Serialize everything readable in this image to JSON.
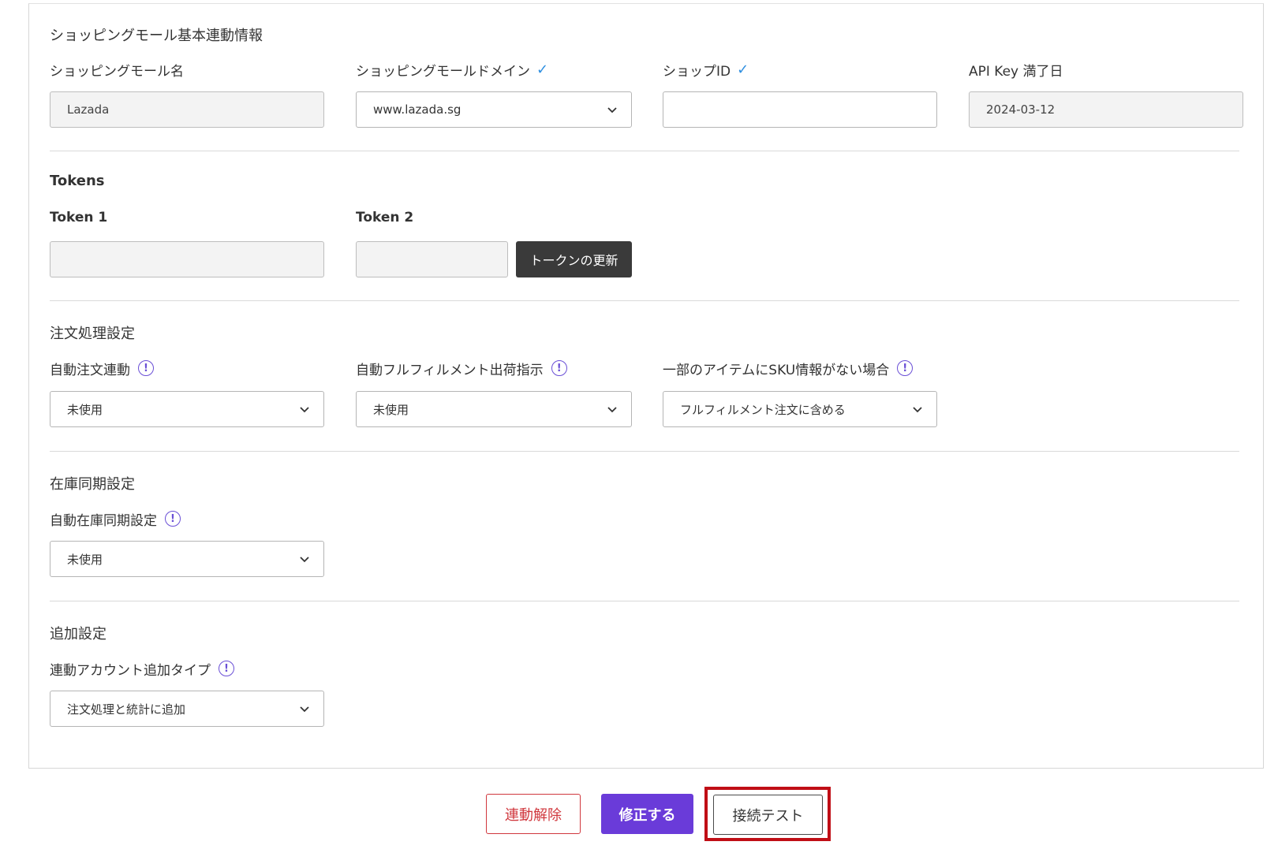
{
  "basic": {
    "title": "ショッピングモール基本連動情報",
    "mall_name_label": "ショッピングモール名",
    "mall_name_value": "Lazada",
    "domain_label": "ショッピングモールドメイン",
    "domain_value": "www.lazada.sg",
    "shop_id_label": "ショップID",
    "shop_id_value": "",
    "api_key_label": "API Key 満了日",
    "api_key_value": "2024-03-12"
  },
  "tokens": {
    "title": "Tokens",
    "token1_label": "Token 1",
    "token1_value": "",
    "token2_label": "Token 2",
    "token2_value": "",
    "refresh_label": "トークンの更新"
  },
  "order": {
    "title": "注文処理設定",
    "auto_order_label": "自動注文連動",
    "auto_order_value": "未使用",
    "auto_fulfillment_label": "自動フルフィルメント出荷指示",
    "auto_fulfillment_value": "未使用",
    "no_sku_label": "一部のアイテムにSKU情報がない場合",
    "no_sku_value": "フルフィルメント注文に含める"
  },
  "stock": {
    "title": "在庫同期設定",
    "auto_stock_label": "自動在庫同期設定",
    "auto_stock_value": "未使用"
  },
  "extra": {
    "title": "追加設定",
    "account_type_label": "連動アカウント追加タイプ",
    "account_type_value": "注文処理と統計に追加"
  },
  "actions": {
    "unlink_label": "連動解除",
    "edit_label": "修正する",
    "test_label": "接続テスト"
  },
  "icons": {
    "check": "✓",
    "info": "!"
  },
  "colors": {
    "primary": "#6a3bd9",
    "danger": "#d0373d",
    "highlight": "#c00e16",
    "check": "#2f8fe0"
  }
}
